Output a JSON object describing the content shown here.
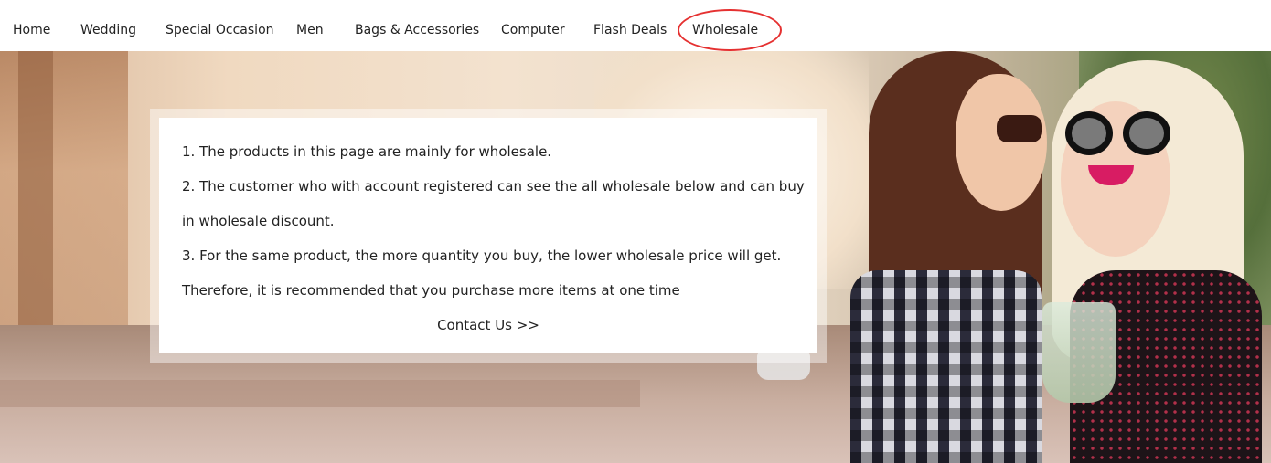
{
  "nav": {
    "items": [
      {
        "label": "Home"
      },
      {
        "label": "Wedding"
      },
      {
        "label": "Special Occasion"
      },
      {
        "label": "Men"
      },
      {
        "label": "Bags & Accessories"
      },
      {
        "label": "Computer"
      },
      {
        "label": "Flash Deals"
      },
      {
        "label": "Wholesale"
      }
    ],
    "highlight_color": "#e53131"
  },
  "info": {
    "lines": [
      "1. The products in this page are mainly for wholesale.",
      "2. The customer who with account registered can see the all wholesale below and can buy",
      "in wholesale discount.",
      "3. For the same product, the more quantity you buy, the lower wholesale price will get.",
      "Therefore, it is recommended that you purchase more items at one time"
    ],
    "contact_label": "Contact Us >>"
  }
}
